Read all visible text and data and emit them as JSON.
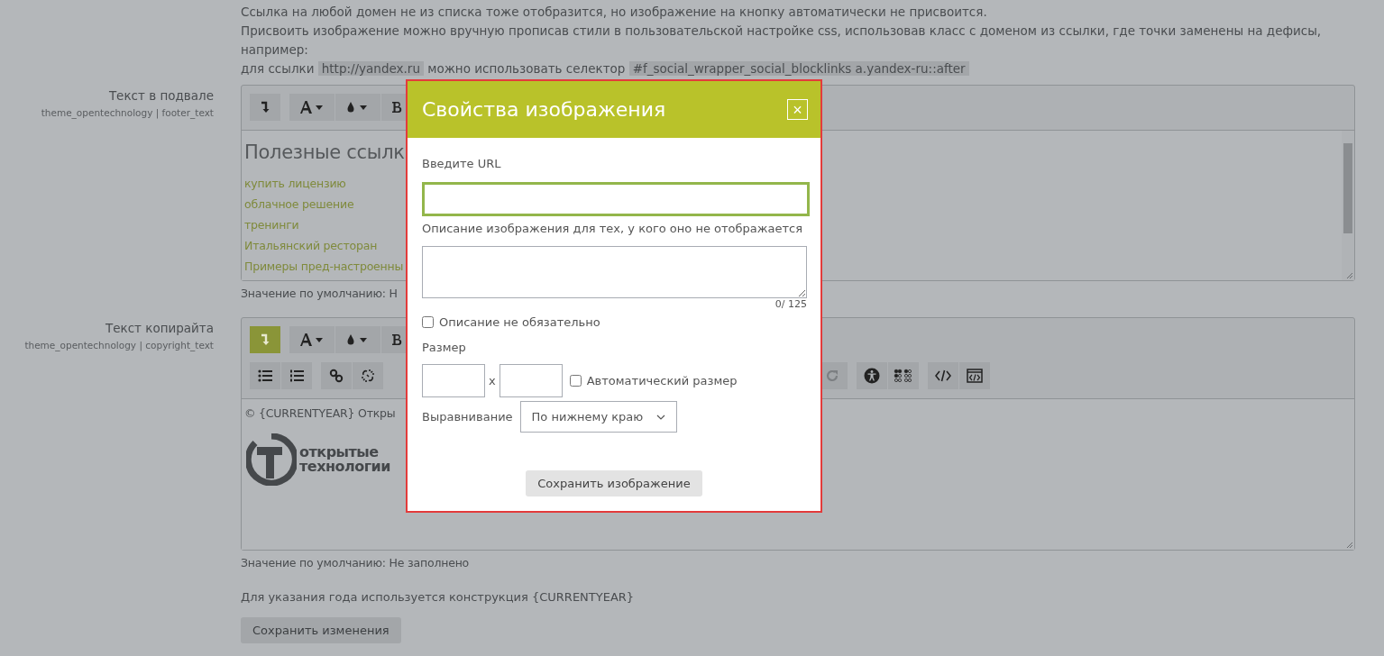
{
  "intro": [
    [
      {
        "text": "Ссылка на любой домен не из списка тоже отобразится, но изображение на кнопку автоматически не присвоится.",
        "kind": "plain"
      }
    ],
    [
      {
        "text": "Присвоить изображение можно вручную прописав стили в пользовательской настройке css, использовав класс с доменом из ссылки, где точки заменены на дефисы, например:",
        "kind": "plain"
      }
    ],
    [
      {
        "text": "для ссылки ",
        "kind": "plain"
      },
      {
        "text": "http://yandex.ru",
        "kind": "code"
      },
      {
        "text": " можно использовать селектор ",
        "kind": "plain"
      },
      {
        "text": "#f_social_wrapper_social_blocklinks a.yandex-ru::after",
        "kind": "code"
      }
    ]
  ],
  "settings": [
    {
      "label": "Текст в подвале",
      "key": "theme_opentechnology | footer_text",
      "toolbar": [
        [
          {
            "kind": "paragraph",
            "active": false
          },
          {
            "kind": "font",
            "active": false
          },
          {
            "kind": "color",
            "active": false
          },
          {
            "kind": "bold",
            "active": false
          }
        ]
      ],
      "content": [
        {
          "kind": "heading",
          "text": "Полезные ссылк"
        },
        {
          "kind": "link",
          "text": "купить лицензию"
        },
        {
          "kind": "link",
          "text": "облачное решение"
        },
        {
          "kind": "link",
          "text": "тренинги"
        },
        {
          "kind": "link",
          "text": "Итальянский ресторан"
        },
        {
          "kind": "link",
          "text": "Примеры пред-настроенны"
        }
      ],
      "scrollable": true,
      "default": "Значение по умолчанию: Н"
    },
    {
      "label": "Текст копирайта",
      "key": "theme_opentechnology | copyright_text",
      "toolbar": [
        [
          {
            "kind": "paragraph",
            "active": true
          },
          {
            "kind": "font",
            "active": false
          },
          {
            "kind": "color",
            "active": false
          },
          {
            "kind": "bold",
            "active": false
          }
        ],
        [
          {
            "kind": "bullets",
            "active": false
          },
          {
            "kind": "numbers",
            "active": false
          },
          {
            "kind": "link",
            "active": false
          },
          {
            "kind": "unlink",
            "active": false
          }
        ]
      ],
      "toolbar_right": [
        {
          "kind": "redo",
          "active": false
        },
        {
          "kind": "accessibility",
          "active": false
        },
        {
          "kind": "braille",
          "active": false
        },
        {
          "kind": "code",
          "active": false
        },
        {
          "kind": "html",
          "active": false
        }
      ],
      "content": [
        {
          "kind": "copyright",
          "text": "© {CURRENTYEAR} Откры"
        },
        {
          "kind": "logo",
          "lines": [
            "открытые",
            "технологии"
          ]
        }
      ],
      "scrollable": false,
      "default": "Значение по умолчанию: Не заполнено"
    }
  ],
  "note": "Для указания года используется конструкция {CURRENTYEAR}",
  "save_button": "Сохранить изменения",
  "dialog": {
    "title": "Свойства изображения",
    "close": "×",
    "url_label": "Введите URL",
    "alt_label": "Описание изображения для тех, у кого оно не отображается",
    "alt_counter": "0/ 125",
    "alt_optional": {
      "label": "Описание не обязательно",
      "checked": false
    },
    "size_label": "Размер",
    "size_separator": "x",
    "auto_size": {
      "label": "Автоматический размер",
      "checked": false
    },
    "align_label": "Выравнивание",
    "align_value": "По нижнему краю",
    "save": "Сохранить изображение"
  }
}
